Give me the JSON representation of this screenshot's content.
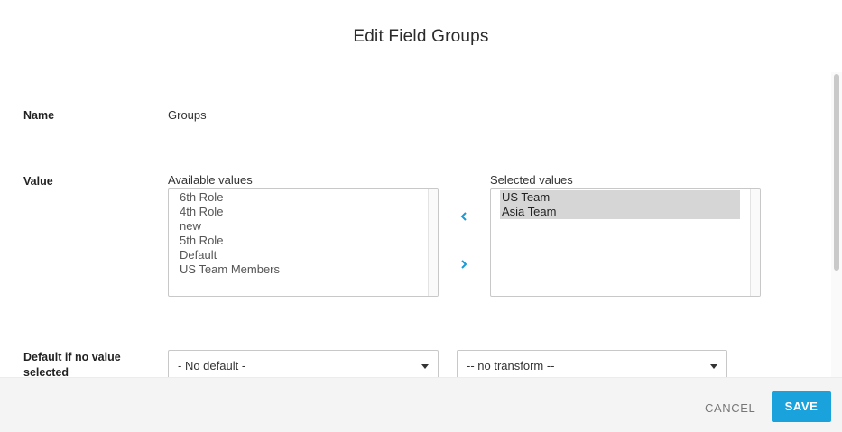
{
  "dialog": {
    "title": "Edit Field Groups"
  },
  "form": {
    "name_label": "Name",
    "name_value": "Groups",
    "value_label": "Value",
    "available_caption": "Available values",
    "selected_caption": "Selected values",
    "available_values": [
      "6th Role",
      "4th Role",
      "new",
      "5th Role",
      "Default",
      "US Team Members"
    ],
    "selected_values": [
      "US Team",
      "Asia Team"
    ],
    "move_left_icon": "chevron-left-icon",
    "move_right_icon": "chevron-right-icon",
    "default_label": "Default if no value selected",
    "default_select_value": "- No default -",
    "transform_select_value": "-- no transform --"
  },
  "footer": {
    "cancel_label": "CANCEL",
    "save_label": "SAVE"
  },
  "colors": {
    "accent": "#1aa2dc",
    "selected_bg": "#d6d6d6",
    "footer_bg": "#f4f4f4"
  }
}
